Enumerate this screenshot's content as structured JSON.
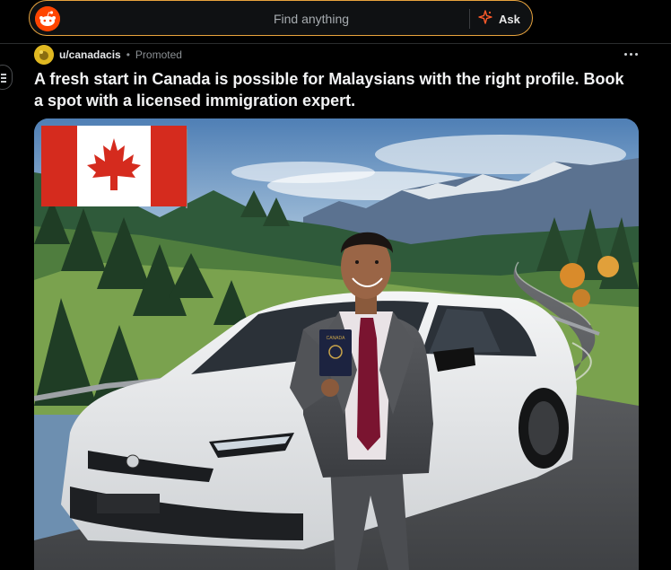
{
  "header": {
    "search_placeholder": "Find anything",
    "ask_label": "Ask",
    "logo_icon": "reddit-snoo-icon",
    "ask_icon": "sparkle-icon",
    "accent_color": "#e8a33d",
    "brand_color": "#ff4500"
  },
  "post": {
    "author": "u/canadacis",
    "separator": "•",
    "promoted_label": "Promoted",
    "title": "A fresh start in Canada is possible for Malaysians with the right profile. Book a spot with a licensed immigration expert.",
    "more_icon": "more-horizontal-icon",
    "media": {
      "description_icon": "ad-image",
      "passport_text": "CANADA"
    }
  }
}
